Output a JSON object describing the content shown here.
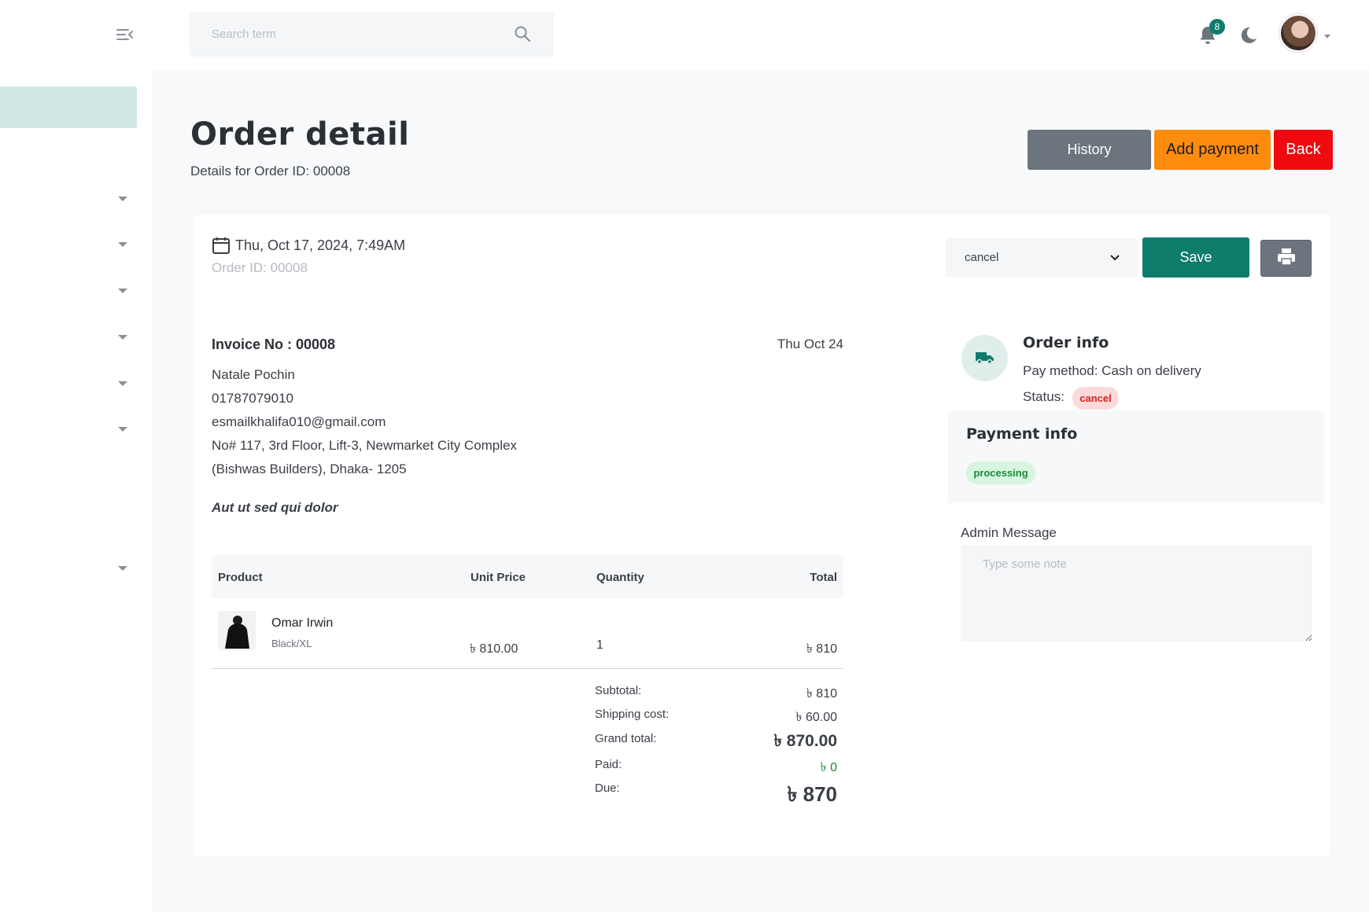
{
  "search": {
    "placeholder": "Search term"
  },
  "topbar": {
    "notification_count": "8"
  },
  "page": {
    "title": "Order detail",
    "subtitle": "Details for Order ID: 00008"
  },
  "actions": {
    "history": "History",
    "add_payment": "Add payment",
    "back": "Back"
  },
  "order": {
    "datetime": "Thu, Oct 17, 2024, 7:49AM",
    "order_id_line": "Order ID: 00008",
    "status_value": "cancel",
    "save": "Save"
  },
  "invoice": {
    "number": "Invoice No : 00008",
    "date": "Thu Oct 24",
    "customer": {
      "name": "Natale Pochin",
      "phone": "01787079010",
      "email": "esmailkhalifa010@gmail.com",
      "address_line1": "No# 117, 3rd Floor, Lift-3, Newmarket City Complex",
      "address_line2": "(Bishwas Builders), Dhaka- 1205"
    },
    "note": "Aut ut sed qui dolor"
  },
  "table": {
    "headers": {
      "product": "Product",
      "unit_price": "Unit Price",
      "quantity": "Quantity",
      "total": "Total"
    },
    "rows": [
      {
        "name": "Omar Irwin",
        "variant": "Black/XL",
        "unit_price": "৳ 810.00",
        "quantity": "1",
        "total": "৳ 810"
      }
    ]
  },
  "summary": {
    "subtotal_label": "Subtotal:",
    "subtotal": "৳ 810",
    "shipping_label": "Shipping cost:",
    "shipping": "৳ 60.00",
    "grand_label": "Grand total:",
    "grand": "৳ 870.00",
    "paid_label": "Paid:",
    "paid": "৳ 0",
    "due_label": "Due:",
    "due": "৳ 870"
  },
  "order_info": {
    "title": "Order info",
    "pay_method": "Pay method: Cash on delivery",
    "status_label": "Status:",
    "status": "cancel"
  },
  "payment_info": {
    "title": "Payment info",
    "status": "processing"
  },
  "admin": {
    "label": "Admin Message",
    "placeholder": "Type some note"
  },
  "colors": {
    "primary": "#0e7c6b",
    "history": "#6c757d",
    "add_payment": "#fd8b0e",
    "back": "#ee0a0f",
    "paid": "#1e8a3c",
    "cancel": "#d62020"
  }
}
